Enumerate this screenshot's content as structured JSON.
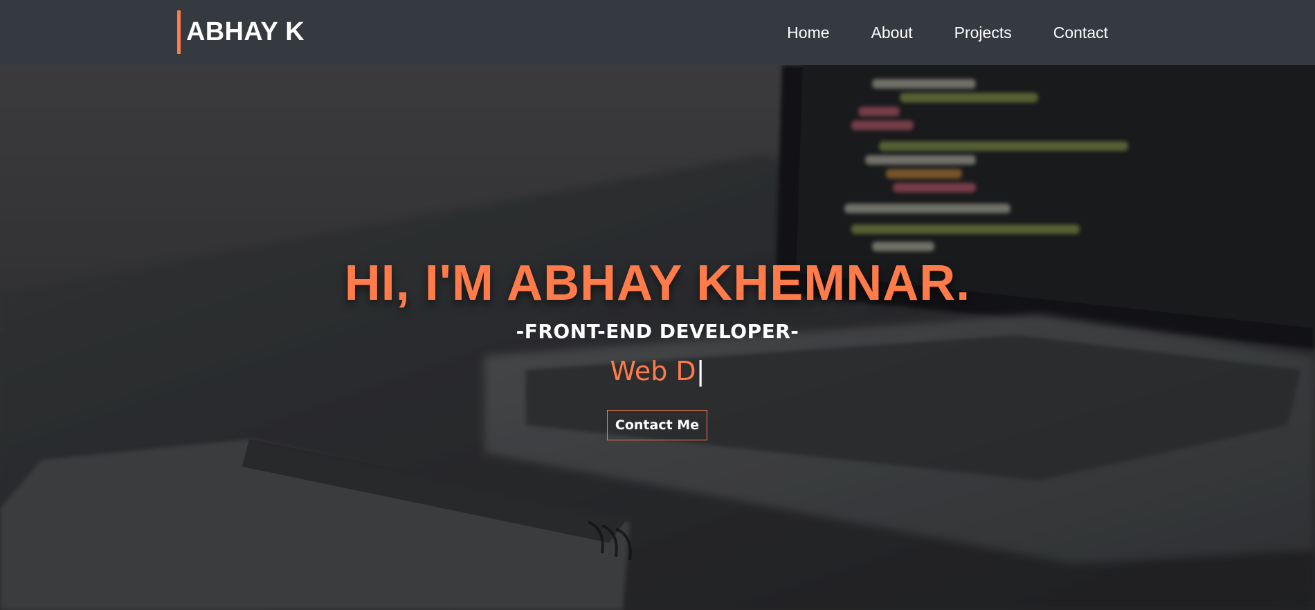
{
  "brand": {
    "name": "ABHAY K"
  },
  "nav": {
    "items": [
      {
        "label": "Home"
      },
      {
        "label": "About"
      },
      {
        "label": "Projects"
      },
      {
        "label": "Contact"
      }
    ]
  },
  "hero": {
    "title": "HI, I'M ABHAY KHEMNAR.",
    "role": "-FRONT-END DEVELOPER-",
    "typed_text": "Web D",
    "caret": "|",
    "cta_label": "Contact Me"
  },
  "colors": {
    "accent": "#ff7b4a",
    "navbar_bg": "#343a40",
    "text": "#ffffff"
  },
  "icons": {
    "caret": "text-cursor-icon"
  }
}
